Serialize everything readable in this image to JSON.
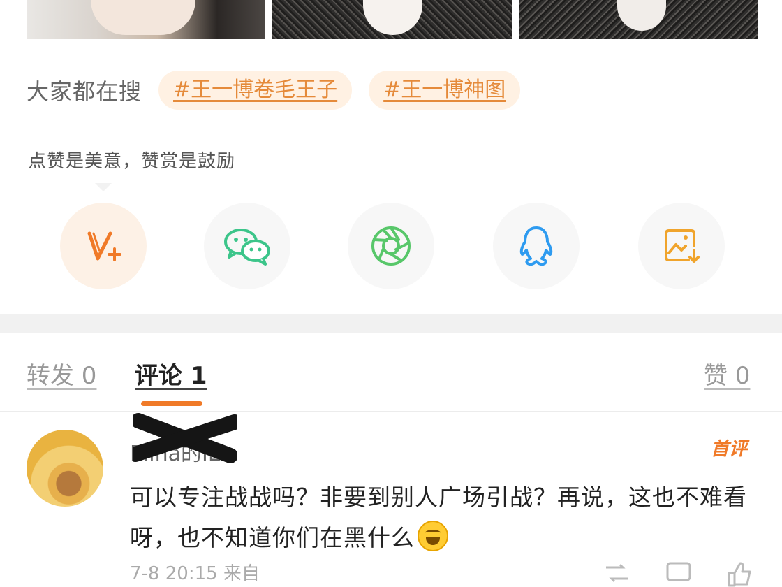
{
  "hot_search": {
    "label": "大家都在搜",
    "tags": [
      "#王一博卷毛王子",
      "#王一博神图"
    ]
  },
  "tooltip": "点赞是美意，赞赏是鼓励",
  "share_icons": [
    "vip-plus-icon",
    "wechat-icon",
    "moments-icon",
    "qq-icon",
    "save-image-icon"
  ],
  "tabs": {
    "repost": "转发 0",
    "comments": "评论 1",
    "likes": "赞 0"
  },
  "comment": {
    "username": "Elina的IE",
    "badge": "首评",
    "text": "可以专注战战吗？非要到别人广场引战？再说，这也不难看呀，也不知道你们在黑什么",
    "meta": "7-8 20:15 来自"
  },
  "colors": {
    "accent": "#f07a28",
    "tag_text": "#e58a3a",
    "tag_bg": "#fff1e3",
    "wechat": "#3cc58a",
    "moments": "#58c76a",
    "qq": "#2e9bf0",
    "save": "#f0a42c"
  }
}
